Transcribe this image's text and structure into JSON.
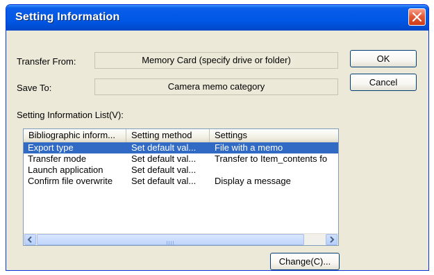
{
  "window": {
    "title": "Setting Information"
  },
  "form": {
    "transfer_from_label": "Transfer From:",
    "transfer_from_value": "Memory Card (specify drive or folder)",
    "save_to_label": "Save To:",
    "save_to_value": "Camera memo category",
    "list_label": "Setting Information List(V):"
  },
  "buttons": {
    "ok_label": "OK",
    "cancel_label": "Cancel",
    "change_label": "Change(C)..."
  },
  "list": {
    "columns": [
      "Bibliographic inform...",
      "Setting method",
      "Settings"
    ],
    "rows": [
      [
        "Export type",
        "Set default val...",
        "File with a memo"
      ],
      [
        "Transfer mode",
        "Set default val...",
        "Transfer to Item_contents fo"
      ],
      [
        "Launch application",
        "Set default val...",
        ""
      ],
      [
        "Confirm file overwrite",
        "Set default val...",
        "Display a message"
      ]
    ],
    "selected_row_index": 0
  },
  "icons": {
    "close": "close-icon",
    "scroll_left": "scroll-left-arrow-icon",
    "scroll_right": "scroll-right-arrow-icon",
    "grip": "scroll-grip-icon"
  },
  "colors": {
    "titlebar": "#0058e6",
    "dialog_bg": "#ece9d8",
    "selection": "#316ac5",
    "close_button": "#e45b3a"
  }
}
